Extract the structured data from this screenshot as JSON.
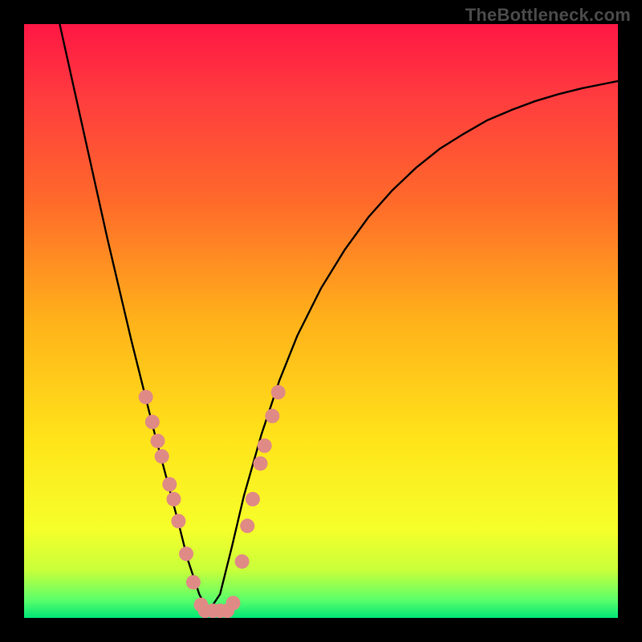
{
  "watermark": "TheBottleneck.com",
  "chart_data": {
    "type": "line",
    "title": "",
    "xlabel": "",
    "ylabel": "",
    "xlim": [
      0,
      1
    ],
    "ylim": [
      0,
      1
    ],
    "background_gradient": {
      "stops": [
        {
          "pos": 0.0,
          "color": "#ff1744"
        },
        {
          "pos": 0.12,
          "color": "#ff3b3f"
        },
        {
          "pos": 0.3,
          "color": "#ff6a2a"
        },
        {
          "pos": 0.5,
          "color": "#ffb21a"
        },
        {
          "pos": 0.7,
          "color": "#ffe41a"
        },
        {
          "pos": 0.85,
          "color": "#f6ff2a"
        },
        {
          "pos": 0.92,
          "color": "#c8ff3a"
        },
        {
          "pos": 0.97,
          "color": "#5aff6a"
        },
        {
          "pos": 1.0,
          "color": "#00e676"
        }
      ]
    },
    "series": [
      {
        "name": "bottleneck-curve",
        "color": "#000000",
        "x": [
          0.06,
          0.08,
          0.1,
          0.12,
          0.14,
          0.16,
          0.18,
          0.2,
          0.22,
          0.24,
          0.26,
          0.275,
          0.295,
          0.31,
          0.33,
          0.35,
          0.37,
          0.4,
          0.43,
          0.46,
          0.5,
          0.54,
          0.58,
          0.62,
          0.66,
          0.7,
          0.74,
          0.78,
          0.82,
          0.86,
          0.9,
          0.94,
          0.98,
          1.0
        ],
        "y": [
          1.0,
          0.91,
          0.82,
          0.73,
          0.64,
          0.555,
          0.47,
          0.39,
          0.31,
          0.235,
          0.16,
          0.1,
          0.04,
          0.01,
          0.04,
          0.12,
          0.205,
          0.31,
          0.4,
          0.475,
          0.555,
          0.62,
          0.675,
          0.72,
          0.758,
          0.79,
          0.815,
          0.838,
          0.855,
          0.87,
          0.882,
          0.892,
          0.9,
          0.904
        ]
      }
    ],
    "markers": {
      "name": "highlight-dots",
      "color": "#e08a86",
      "radius": 9,
      "points": [
        {
          "x": 0.205,
          "y": 0.372
        },
        {
          "x": 0.216,
          "y": 0.33
        },
        {
          "x": 0.225,
          "y": 0.298
        },
        {
          "x": 0.232,
          "y": 0.272
        },
        {
          "x": 0.245,
          "y": 0.225
        },
        {
          "x": 0.252,
          "y": 0.2
        },
        {
          "x": 0.26,
          "y": 0.163
        },
        {
          "x": 0.273,
          "y": 0.108
        },
        {
          "x": 0.285,
          "y": 0.06
        },
        {
          "x": 0.298,
          "y": 0.022
        },
        {
          "x": 0.305,
          "y": 0.012
        },
        {
          "x": 0.318,
          "y": 0.012
        },
        {
          "x": 0.33,
          "y": 0.012
        },
        {
          "x": 0.342,
          "y": 0.012
        },
        {
          "x": 0.352,
          "y": 0.025
        },
        {
          "x": 0.367,
          "y": 0.095
        },
        {
          "x": 0.376,
          "y": 0.155
        },
        {
          "x": 0.385,
          "y": 0.2
        },
        {
          "x": 0.398,
          "y": 0.26
        },
        {
          "x": 0.405,
          "y": 0.29
        },
        {
          "x": 0.418,
          "y": 0.34
        },
        {
          "x": 0.428,
          "y": 0.38
        }
      ]
    }
  }
}
